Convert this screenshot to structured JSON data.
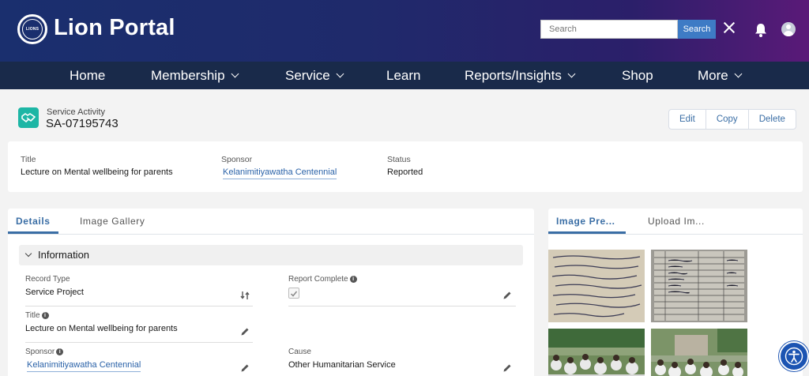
{
  "header": {
    "brand": "Lion Portal",
    "logo_text": "LIONS",
    "search_placeholder": "Search",
    "search_button": "Search"
  },
  "nav": {
    "items": [
      {
        "label": "Home"
      },
      {
        "label": "Membership"
      },
      {
        "label": "Service"
      },
      {
        "label": "Learn"
      },
      {
        "label": "Reports/Insights"
      },
      {
        "label": "Shop"
      },
      {
        "label": "More"
      }
    ]
  },
  "record": {
    "type_label": "Service Activity",
    "id": "SA-07195743",
    "actions": {
      "edit": "Edit",
      "copy": "Copy",
      "delete": "Delete"
    }
  },
  "highlights": {
    "title_label": "Title",
    "title_value": "Lecture on Mental wellbeing for parents",
    "sponsor_label": "Sponsor",
    "sponsor_value": "Kelanimitiyawatha Centennial",
    "status_label": "Status",
    "status_value": "Reported"
  },
  "details": {
    "tabs": [
      "Details",
      "Image Gallery"
    ],
    "section_title": "Information",
    "fields": {
      "record_type_label": "Record Type",
      "record_type_value": "Service Project",
      "report_complete_label": "Report Complete",
      "report_complete_value": true,
      "title_label": "Title",
      "title_value": "Lecture on Mental wellbeing for parents",
      "sponsor_label": "Sponsor",
      "sponsor_value": "Kelanimitiyawatha Centennial",
      "cause_label": "Cause",
      "cause_value": "Other Humanitarian Service"
    }
  },
  "image_panel": {
    "tabs": [
      "Image Pre...",
      "Upload Im..."
    ]
  },
  "colors": {
    "accent": "#3a6ea5",
    "nav_bg": "#192a4a",
    "record_icon": "#1db6a5",
    "search_button": "#3e7bc5"
  },
  "icons": [
    "lions-logo",
    "close-icon",
    "bell-icon",
    "avatar-icon",
    "service-activity-icon",
    "chevron-down-icon",
    "info-icon",
    "pencil-icon",
    "swap-icon",
    "accessibility-icon"
  ]
}
